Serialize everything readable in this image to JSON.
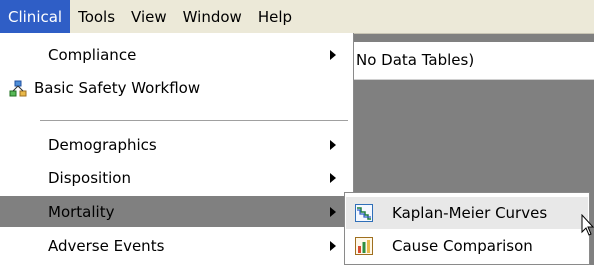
{
  "menubar": {
    "items": [
      {
        "label": "Clinical"
      },
      {
        "label": "Tools"
      },
      {
        "label": "View"
      },
      {
        "label": "Window"
      },
      {
        "label": "Help"
      }
    ]
  },
  "background_panel": {
    "text": "No Data Tables)"
  },
  "clinical_menu": {
    "items": [
      {
        "label": "Compliance",
        "has_submenu": true
      },
      {
        "label": "Basic Safety Workflow",
        "icon": "workflow-icon"
      },
      {
        "label": "Demographics",
        "has_submenu": true
      },
      {
        "label": "Disposition",
        "has_submenu": true
      },
      {
        "label": "Mortality",
        "has_submenu": true,
        "highlighted": true
      },
      {
        "label": "Adverse Events",
        "has_submenu": true
      }
    ]
  },
  "mortality_submenu": {
    "items": [
      {
        "label": "Kaplan-Meier Curves",
        "icon": "kaplan-meier-icon",
        "hovered": true
      },
      {
        "label": "Cause Comparison",
        "icon": "cause-comparison-icon"
      }
    ]
  },
  "colors": {
    "menubar_bg": "#ece9d8",
    "active_menu_bg": "#2f5ec6",
    "highlight_bg": "#808080",
    "desktop_bg": "#808080"
  }
}
